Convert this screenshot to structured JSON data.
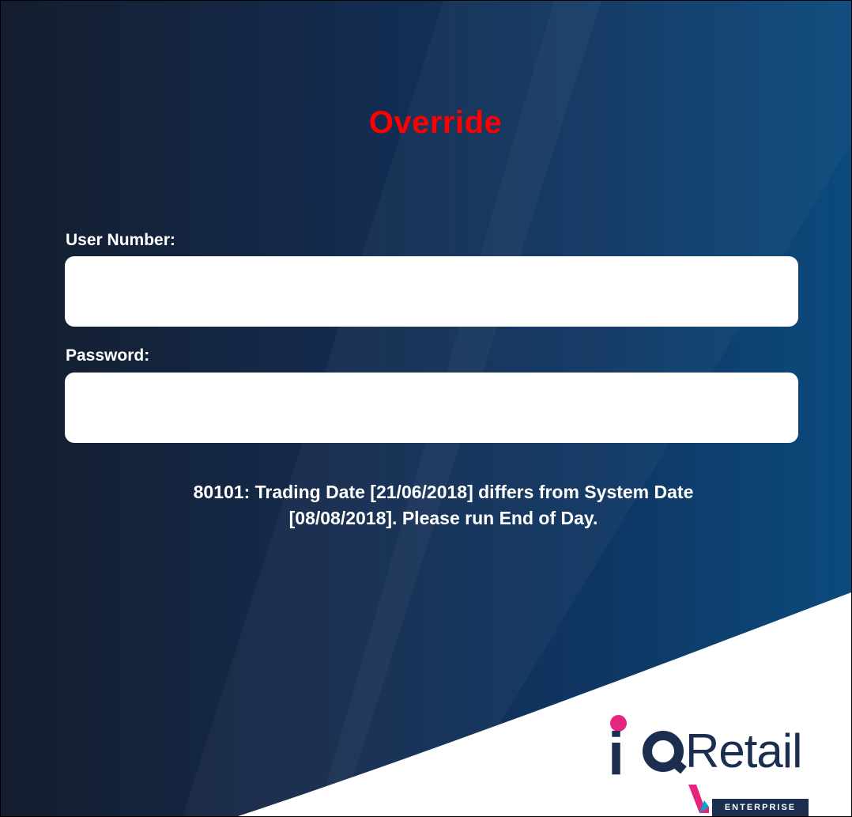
{
  "dialog": {
    "title": "Override",
    "title_color": "#ff0000",
    "background_colors": [
      "#141d2e",
      "#0b4a7c"
    ]
  },
  "form": {
    "user_number_label": "User Number:",
    "user_number_value": "",
    "password_label": "Password:",
    "password_value": ""
  },
  "message": {
    "line1": "80101: Trading Date [21/06/2018] differs from System Date",
    "line2": "[08/08/2018]. Please run End of Day."
  },
  "logo": {
    "brand_text": "Retail",
    "badge_text": "ENTERPRISE",
    "brand_color": "#1b2e4f",
    "accent_color": "#e6257f",
    "check_color": "#00a5c8"
  }
}
